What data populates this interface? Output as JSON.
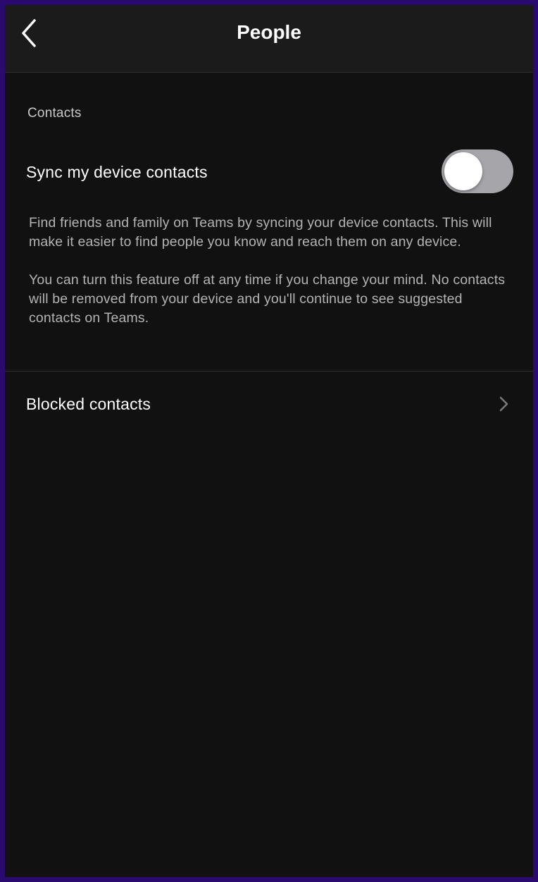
{
  "header": {
    "title": "People",
    "back_icon": "chevron-left-icon"
  },
  "contacts_section": {
    "label": "Contacts",
    "sync": {
      "label": "Sync my device contacts",
      "enabled": false
    },
    "description": [
      "Find friends and family on Teams by syncing your device contacts. This will make it easier to find people you know and reach them on any device.",
      "You can turn this feature off at any time if you change your mind. No contacts will be removed from your device and you'll continue to see suggested contacts on Teams."
    ]
  },
  "blocked": {
    "label": "Blocked contacts",
    "icon": "chevron-right-icon"
  },
  "colors": {
    "background": "#111111",
    "header": "#1c1b1b",
    "border_outer": "#2a0a6e",
    "toggle_off": "#a6a5aa"
  }
}
